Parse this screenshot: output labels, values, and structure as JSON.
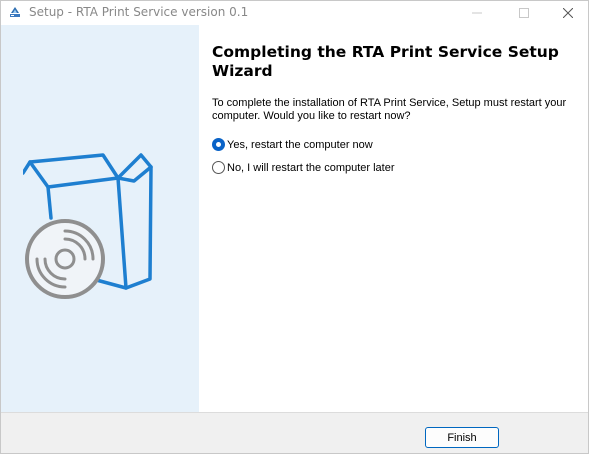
{
  "window": {
    "title": "Setup - RTA Print Service version 0.1",
    "app_icon": "setup-icon",
    "controls": [
      "minimize-icon",
      "maximize-icon",
      "close-icon"
    ]
  },
  "side_panel": {
    "illustration": "box-with-disc-icon",
    "background_color": "#e6f1fa",
    "accent_color": "#1e7fd0"
  },
  "main": {
    "heading": "Completing the RTA Print Service Setup Wizard",
    "description": "To complete the installation of RTA Print Service, Setup must restart your computer. Would you like to restart now?",
    "options": [
      {
        "label": "Yes, restart the computer now",
        "selected": true
      },
      {
        "label": "No, I will restart the computer later",
        "selected": false
      }
    ]
  },
  "footer": {
    "finish_label": "Finish"
  },
  "colors": {
    "radio_accent": "#0a63c7",
    "button_border": "#0067c0"
  }
}
